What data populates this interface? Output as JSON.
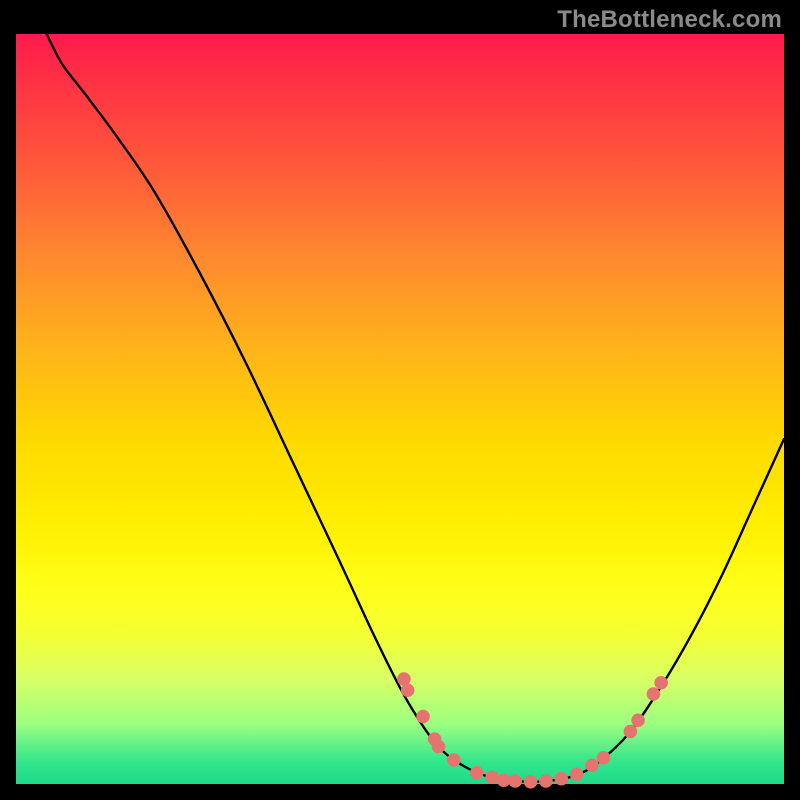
{
  "watermark": "TheBottleneck.com",
  "colors": {
    "point": "#e5736f",
    "curve": "#000000",
    "frame": "#000000"
  },
  "chart_data": {
    "type": "line",
    "title": "",
    "xlabel": "",
    "ylabel": "",
    "xlim": [
      0,
      100
    ],
    "ylim": [
      0,
      100
    ],
    "curve": [
      {
        "x": 4.0,
        "y": 100.0
      },
      {
        "x": 6.0,
        "y": 96.0
      },
      {
        "x": 9.0,
        "y": 92.0
      },
      {
        "x": 13.0,
        "y": 86.5
      },
      {
        "x": 18.0,
        "y": 79.0
      },
      {
        "x": 24.0,
        "y": 68.0
      },
      {
        "x": 30.0,
        "y": 56.0
      },
      {
        "x": 36.0,
        "y": 43.0
      },
      {
        "x": 42.0,
        "y": 30.0
      },
      {
        "x": 47.0,
        "y": 19.0
      },
      {
        "x": 51.0,
        "y": 11.0
      },
      {
        "x": 55.0,
        "y": 5.0
      },
      {
        "x": 59.0,
        "y": 2.0
      },
      {
        "x": 63.0,
        "y": 0.6
      },
      {
        "x": 67.0,
        "y": 0.3
      },
      {
        "x": 70.0,
        "y": 0.5
      },
      {
        "x": 73.0,
        "y": 1.2
      },
      {
        "x": 76.0,
        "y": 3.0
      },
      {
        "x": 80.0,
        "y": 7.0
      },
      {
        "x": 84.0,
        "y": 13.0
      },
      {
        "x": 88.0,
        "y": 20.0
      },
      {
        "x": 92.0,
        "y": 28.0
      },
      {
        "x": 96.0,
        "y": 37.0
      },
      {
        "x": 100.0,
        "y": 46.0
      }
    ],
    "points": [
      {
        "x": 50.5,
        "y": 14.0
      },
      {
        "x": 51.0,
        "y": 12.5
      },
      {
        "x": 53.0,
        "y": 9.0
      },
      {
        "x": 54.5,
        "y": 6.0
      },
      {
        "x": 55.0,
        "y": 5.0
      },
      {
        "x": 57.0,
        "y": 3.2
      },
      {
        "x": 60.0,
        "y": 1.5
      },
      {
        "x": 62.0,
        "y": 0.9
      },
      {
        "x": 63.5,
        "y": 0.5
      },
      {
        "x": 65.0,
        "y": 0.4
      },
      {
        "x": 67.0,
        "y": 0.3
      },
      {
        "x": 69.0,
        "y": 0.4
      },
      {
        "x": 71.0,
        "y": 0.7
      },
      {
        "x": 73.0,
        "y": 1.3
      },
      {
        "x": 75.0,
        "y": 2.5
      },
      {
        "x": 76.5,
        "y": 3.5
      },
      {
        "x": 80.0,
        "y": 7.0
      },
      {
        "x": 81.0,
        "y": 8.5
      },
      {
        "x": 83.0,
        "y": 12.0
      },
      {
        "x": 84.0,
        "y": 13.5
      }
    ]
  }
}
